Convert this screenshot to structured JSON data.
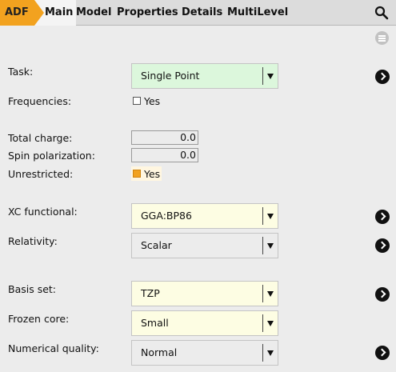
{
  "tabs": {
    "adf": "ADF",
    "items": [
      "Main",
      "Model",
      "Properties",
      "Details",
      "MultiLevel"
    ],
    "active": "Main"
  },
  "toolbar": {
    "search_icon": "search-icon",
    "menu_icon": "menu-icon"
  },
  "colors": {
    "accent": "#f2a21f",
    "task_bg": "#dcf7dc",
    "field_bg": "#fdfde3"
  },
  "form": {
    "task": {
      "label": "Task:",
      "value": "Single Point"
    },
    "frequencies": {
      "label": "Frequencies:",
      "checkbox_label": "Yes",
      "checked": false
    },
    "total_charge": {
      "label": "Total charge:",
      "value": "0.0"
    },
    "spin_polarization": {
      "label": "Spin polarization:",
      "value": "0.0"
    },
    "unrestricted": {
      "label": "Unrestricted:",
      "checkbox_label": "Yes",
      "checked": true
    },
    "xc_functional": {
      "label": "XC functional:",
      "value": "GGA:BP86"
    },
    "relativity": {
      "label": "Relativity:",
      "value": "Scalar"
    },
    "basis_set": {
      "label": "Basis set:",
      "value": "TZP"
    },
    "frozen_core": {
      "label": "Frozen core:",
      "value": "Small"
    },
    "numerical_quality": {
      "label": "Numerical quality:",
      "value": "Normal"
    }
  }
}
